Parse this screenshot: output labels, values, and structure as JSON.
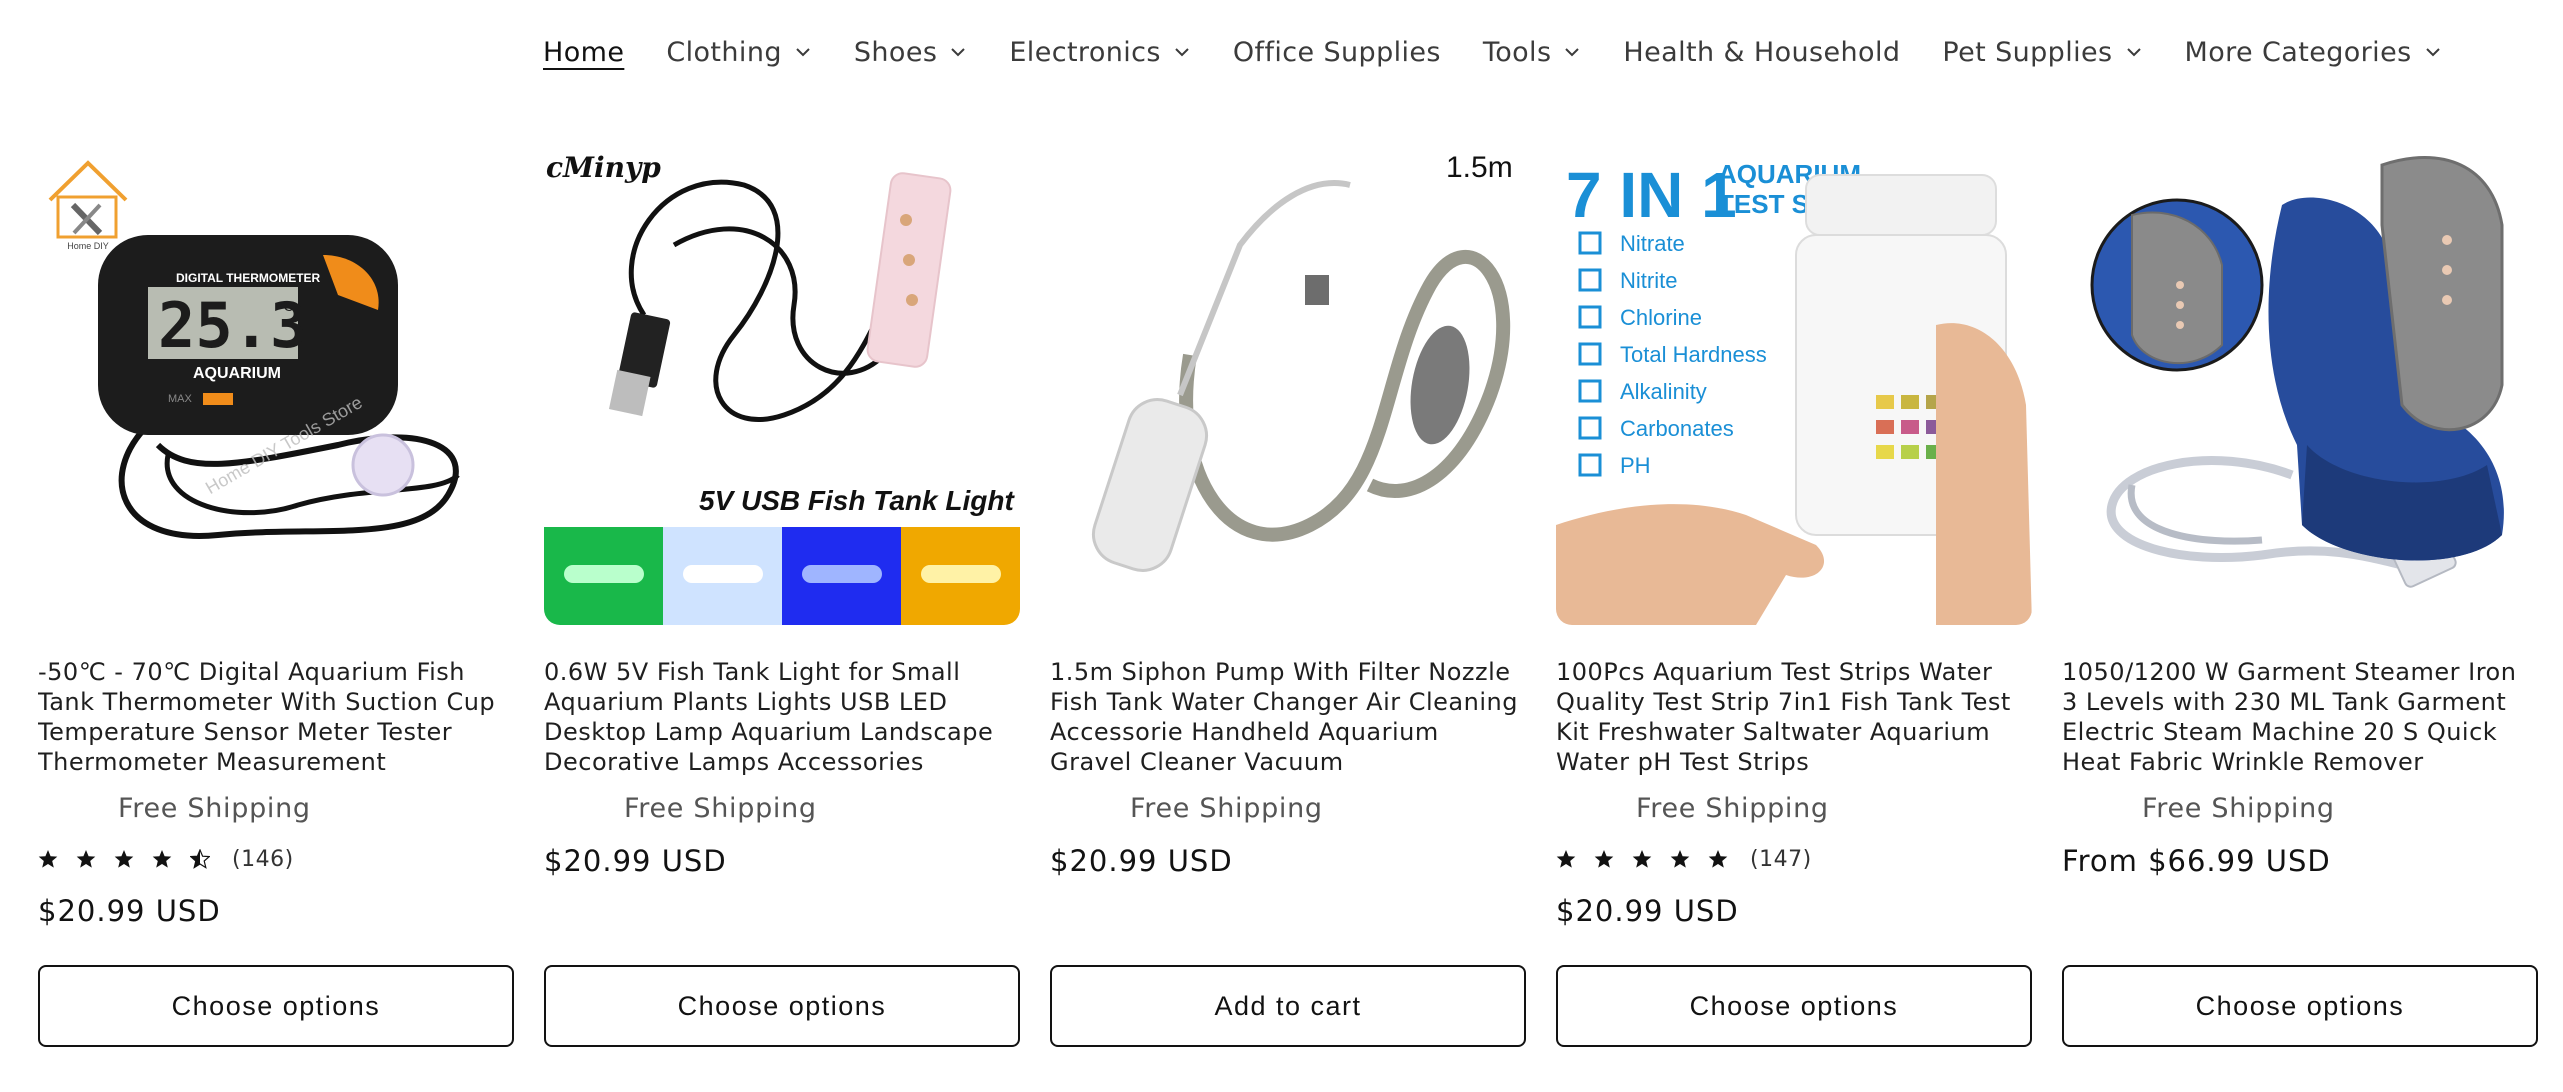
{
  "nav": {
    "items": [
      {
        "label": "Home",
        "active": true,
        "has_dropdown": false
      },
      {
        "label": "Clothing",
        "active": false,
        "has_dropdown": true
      },
      {
        "label": "Shoes",
        "active": false,
        "has_dropdown": true
      },
      {
        "label": "Electronics",
        "active": false,
        "has_dropdown": true
      },
      {
        "label": "Office Supplies",
        "active": false,
        "has_dropdown": false
      },
      {
        "label": "Tools",
        "active": false,
        "has_dropdown": true
      },
      {
        "label": "Health & Household",
        "active": false,
        "has_dropdown": false
      },
      {
        "label": "Pet Supplies",
        "active": false,
        "has_dropdown": true
      },
      {
        "label": "More Categories",
        "active": false,
        "has_dropdown": true
      }
    ]
  },
  "products": [
    {
      "title": "-50℃ - 70℃ Digital Aquarium Fish Tank Thermometer With Suction Cup Temperature Sensor Meter Tester Thermometer Measurement",
      "shipping": "Free Shipping",
      "rating": 4.5,
      "rating_count": "(146)",
      "price": "$20.99 USD",
      "button": "Choose options",
      "image": {
        "brand_text": "Home DIY",
        "display_label": "DIGITAL THERMOMETER",
        "display_value": "25.3",
        "display_unit": "°C",
        "device_label": "AQUARIUM",
        "max_label": "MAX",
        "watermark": "Home DIY Tools Store"
      }
    },
    {
      "title": "0.6W 5V Fish Tank Light for Small Aquarium Plants Lights USB LED Desktop Lamp Aquarium Landscape Decorative Lamps Accessories",
      "shipping": "Free Shipping",
      "rating": null,
      "rating_count": "",
      "price": "$20.99 USD",
      "button": "Choose options",
      "image": {
        "brand_text": "cMinyp",
        "caption": "5V USB Fish Tank Light",
        "swatch_colors": [
          "#19b84a",
          "#cfe3ff",
          "#1f2cf0",
          "#f0a800"
        ]
      }
    },
    {
      "title": "1.5m Siphon Pump With Filter Nozzle Fish Tank Water Changer Air Cleaning Accessorie Handheld Aquarium Gravel Cleaner Vacuum",
      "shipping": "Free Shipping",
      "rating": null,
      "rating_count": "",
      "price": "$20.99 USD",
      "button": "Add to cart",
      "image": {
        "length_label": "1.5m"
      }
    },
    {
      "title": "100Pcs Aquarium Test Strips Water Quality Test Strip 7in1 Fish Tank Test Kit Freshwater Saltwater Aquarium Water pH Test Strips",
      "shipping": "Free Shipping",
      "rating": 5,
      "rating_count": "(147)",
      "price": "$20.99 USD",
      "button": "Choose options",
      "image": {
        "headline": "7 IN 1",
        "subhead_1": "AQUARIUM",
        "subhead_2": "TEST STRIPS",
        "checklist": [
          "Nitrate",
          "Nitrite",
          "Chlorine",
          "Total Hardness",
          "Alkalinity",
          "Carbonates",
          "PH"
        ]
      }
    },
    {
      "title": "1050/1200 W Garment Steamer Iron 3 Levels with 230 ML Tank Garment Electric Steam Machine 20 S Quick Heat Fabric Wrinkle Remover",
      "shipping": "Free Shipping",
      "rating": null,
      "rating_count": "",
      "price": "From $66.99 USD",
      "button": "Choose options",
      "image": {}
    }
  ],
  "colors": {
    "text": "#121212",
    "muted": "#555555",
    "test_strip_blue": "#1a8fd6"
  },
  "icons": {
    "dropdown": "chevron-down-icon",
    "star_full": "star-icon",
    "star_half": "star-half-icon"
  }
}
